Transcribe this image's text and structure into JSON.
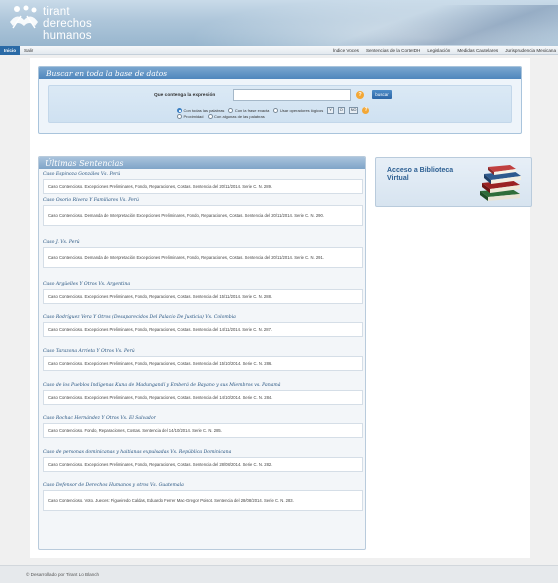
{
  "header": {
    "logo_line1": "tirant",
    "logo_line2": "derechos humanos"
  },
  "nav": {
    "inicio": "Inicio",
    "salir": "Salir",
    "items": [
      "Índice Voces",
      "Sentencias de la CorteIDH",
      "Legislación",
      "Medidas Cautelares",
      "Jurisprudencia Mexicana"
    ]
  },
  "search": {
    "title": "Buscar en toda la base de datos",
    "label": "Que contenga la expresión",
    "input_value": "",
    "button": "buscar",
    "help": "?",
    "options": {
      "all_words": "Con todas las palabras",
      "exact_phrase": "Con la frase exacta",
      "logical_ops": "Usar operadores lógicos",
      "op_y": "Y",
      "op_o": "O",
      "op_no": "NO",
      "proximity": "Proximidad",
      "some_words": "Con algunas de las palabras"
    },
    "selected_option": "all_words"
  },
  "sentencias": {
    "title": "Últimas Sentencias",
    "items": [
      {
        "title": "Caso Espinoza Gonzáles Vs. Perú",
        "desc": "Caso Contencioso. Excepciones Preliminares, Fondo, Reparaciones, Costas. Sentencia del 20/11/2014. Serie C. N. 289."
      },
      {
        "title": "Caso Osorio Rivera Y Familiares Vs. Perú",
        "desc": "Caso Contencioso. Demanda de Interpretación Excepciones Preliminares, Fondo, Reparaciones, Costas. Sentencia del 20/11/2014. Serie C. N. 290."
      },
      {
        "title": "Caso J. Vs. Perú",
        "desc": "Caso Contencioso. Demanda de Interpretación Excepciones Preliminares, Fondo, Reparaciones, Costas. Sentencia del 20/11/2014. Serie C. N. 291."
      },
      {
        "title": "Caso Argüelles Y Otros Vs. Argentina",
        "desc": "Caso Contencioso. Excepciones Preliminares, Fondo, Reparaciones, Costas. Sentencia del 15/11/2014. Serie C. N. 288."
      },
      {
        "title": "Caso Rodríguez Vera Y Otros (Desaparecidos Del Palacio De Justicia) Vs. Colombia",
        "desc": "Caso Contencioso. Excepciones Preliminares, Fondo, Reparaciones, Costas. Sentencia del 14/11/2014. Serie C. N. 287."
      },
      {
        "title": "Caso Tarazona Arrieta Y Otros Vs. Perú",
        "desc": "Caso Contencioso. Excepciones Preliminares, Fondo, Reparaciones, Costas. Sentencia del 15/10/2014. Serie C. N. 286."
      },
      {
        "title": "Caso de los Pueblos Indígenas Kuna de Madungandí y Emberá de Bayano y sus Miembros vs. Panamá",
        "desc": "Caso Contencioso. Excepciones Preliminares, Fondo, Reparaciones, Costas. Sentencia del 14/10/2014. Serie C. N. 284."
      },
      {
        "title": "Caso Rochac Hernández Y Otros Vs. El Salvador",
        "desc": "Caso Contencioso. Fondo, Reparaciones, Costas. Sentencia del 14/10/2014. Serie C. N. 285."
      },
      {
        "title": "Caso de personas dominicanas y haitianas expulsadas Vs. República Dominicana",
        "desc": "Caso Contencioso. Excepciones Preliminares, Fondo, Reparaciones, Costas. Sentencia del 28/08/2014. Serie C. N. 282."
      },
      {
        "title": "Caso Defensor de Derechos Humanos y otros Vs. Guatemala",
        "desc": "Caso Contencioso. Voto. Jueces:  Figueiredo Caldas,  Eduardo Ferrer Mac-Gregor Poisot. Sentencia del 28/08/2014. Serie C. N. 283."
      }
    ]
  },
  "biblioteca": {
    "label": "Acceso a Biblioteca Virtual"
  },
  "footer": {
    "text": "© Desarrollado por Tirant Lo Blanch"
  }
}
